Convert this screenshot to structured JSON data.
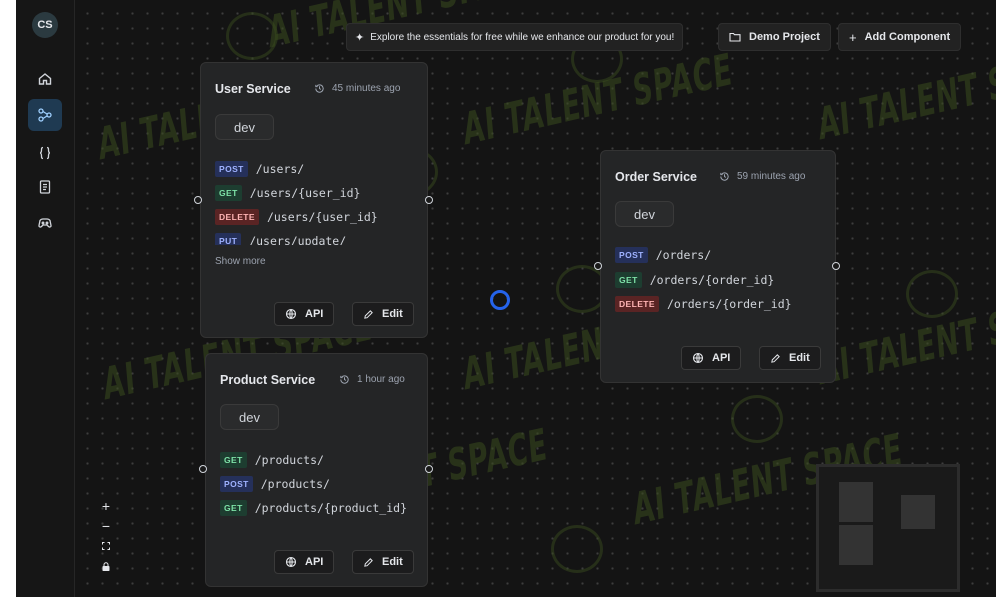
{
  "user": {
    "initials": "CS"
  },
  "sidebar": {
    "items": [
      {
        "icon": "home-icon",
        "active": false
      },
      {
        "icon": "workflow-icon",
        "active": true
      },
      {
        "icon": "braces-icon",
        "active": false
      },
      {
        "icon": "document-icon",
        "active": false
      },
      {
        "icon": "gamepad-icon",
        "active": false
      }
    ]
  },
  "topbar": {
    "banner_text": "Explore the essentials for free while we enhance our product for you!",
    "demo_label": "Demo Project",
    "add_label": "Add Component"
  },
  "watermark_text": "AI TALENT SPACE",
  "services": [
    {
      "title": "User Service",
      "time": "45 minutes ago",
      "env": "dev",
      "endpoints": [
        {
          "method": "POST",
          "path": "/users/"
        },
        {
          "method": "GET",
          "path": "/users/{user_id}"
        },
        {
          "method": "DELETE",
          "path": "/users/{user_id}"
        },
        {
          "method": "PUT",
          "path": "/users/update/"
        }
      ],
      "show_more": "Show more",
      "api_label": "API",
      "edit_label": "Edit"
    },
    {
      "title": "Product Service",
      "time": "1 hour ago",
      "env": "dev",
      "endpoints": [
        {
          "method": "GET",
          "path": "/products/"
        },
        {
          "method": "POST",
          "path": "/products/"
        },
        {
          "method": "GET",
          "path": "/products/{product_id}"
        }
      ],
      "api_label": "API",
      "edit_label": "Edit"
    },
    {
      "title": "Order Service",
      "time": "59 minutes ago",
      "env": "dev",
      "endpoints": [
        {
          "method": "POST",
          "path": "/orders/"
        },
        {
          "method": "GET",
          "path": "/orders/{order_id}"
        },
        {
          "method": "DELETE",
          "path": "/orders/{order_id}"
        }
      ],
      "api_label": "API",
      "edit_label": "Edit"
    }
  ],
  "zoom_controls": {
    "zoom_in": "+",
    "zoom_out": "−"
  },
  "colors": {
    "POST": {
      "bg": "#25305a",
      "fg": "#9fb2ff"
    },
    "GET": {
      "bg": "#1d3d30",
      "fg": "#7ee2a8"
    },
    "DELETE": {
      "bg": "#5a2424",
      "fg": "#ffb4b4"
    },
    "PUT": {
      "bg": "#25305a",
      "fg": "#9fb2ff"
    },
    "accent": "#2563eb"
  }
}
